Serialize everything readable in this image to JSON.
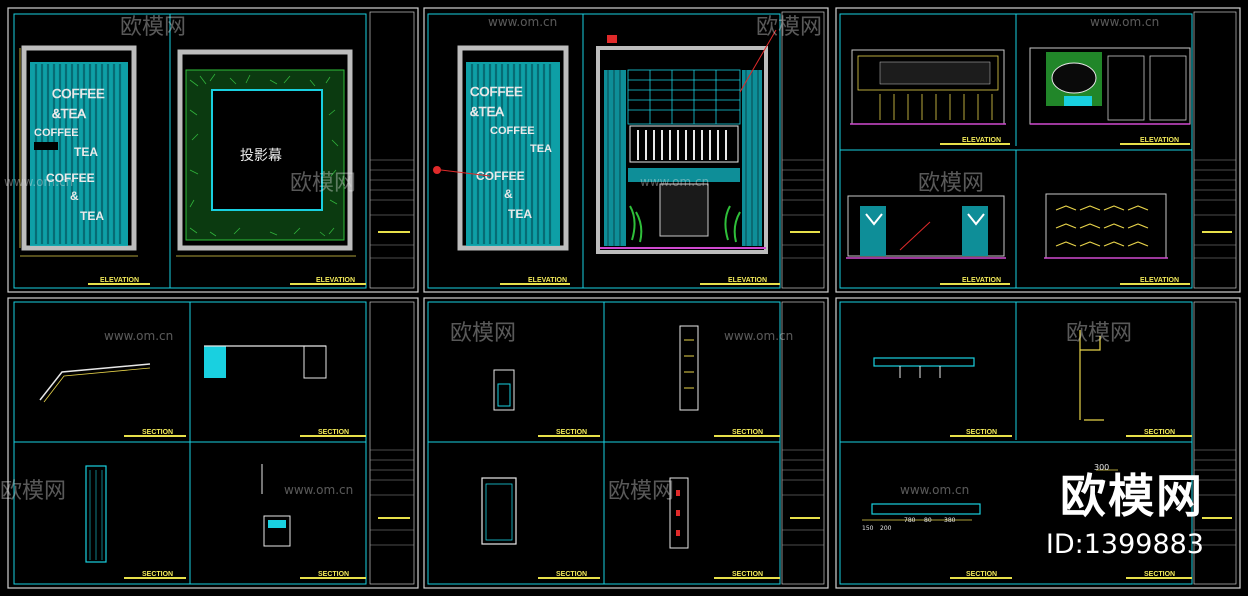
{
  "image": {
    "brand_logo": "欧模网",
    "brand_id": "ID:1399883",
    "watermark_cn": "欧模网",
    "watermark_url": "www.om.cn"
  },
  "panels": {
    "coffee_sign_lines": [
      "COFFEE",
      "&TEA",
      "COFFEE",
      "TEA",
      "COFFEE",
      "&",
      "TEA"
    ],
    "screen_label": "投影幕",
    "elevation_title": "ELEVATION",
    "section_title": "SECTION"
  },
  "dimensions": {
    "top_value": "300",
    "chain": [
      "150",
      "200",
      "780",
      "80",
      "380"
    ]
  },
  "colors": {
    "background": "#000000",
    "cyan": "#19d0e0",
    "yellow": "#f2ea5a",
    "green": "#2fbf3a",
    "magenta": "#d04ad0",
    "red": "#e02a2a"
  }
}
